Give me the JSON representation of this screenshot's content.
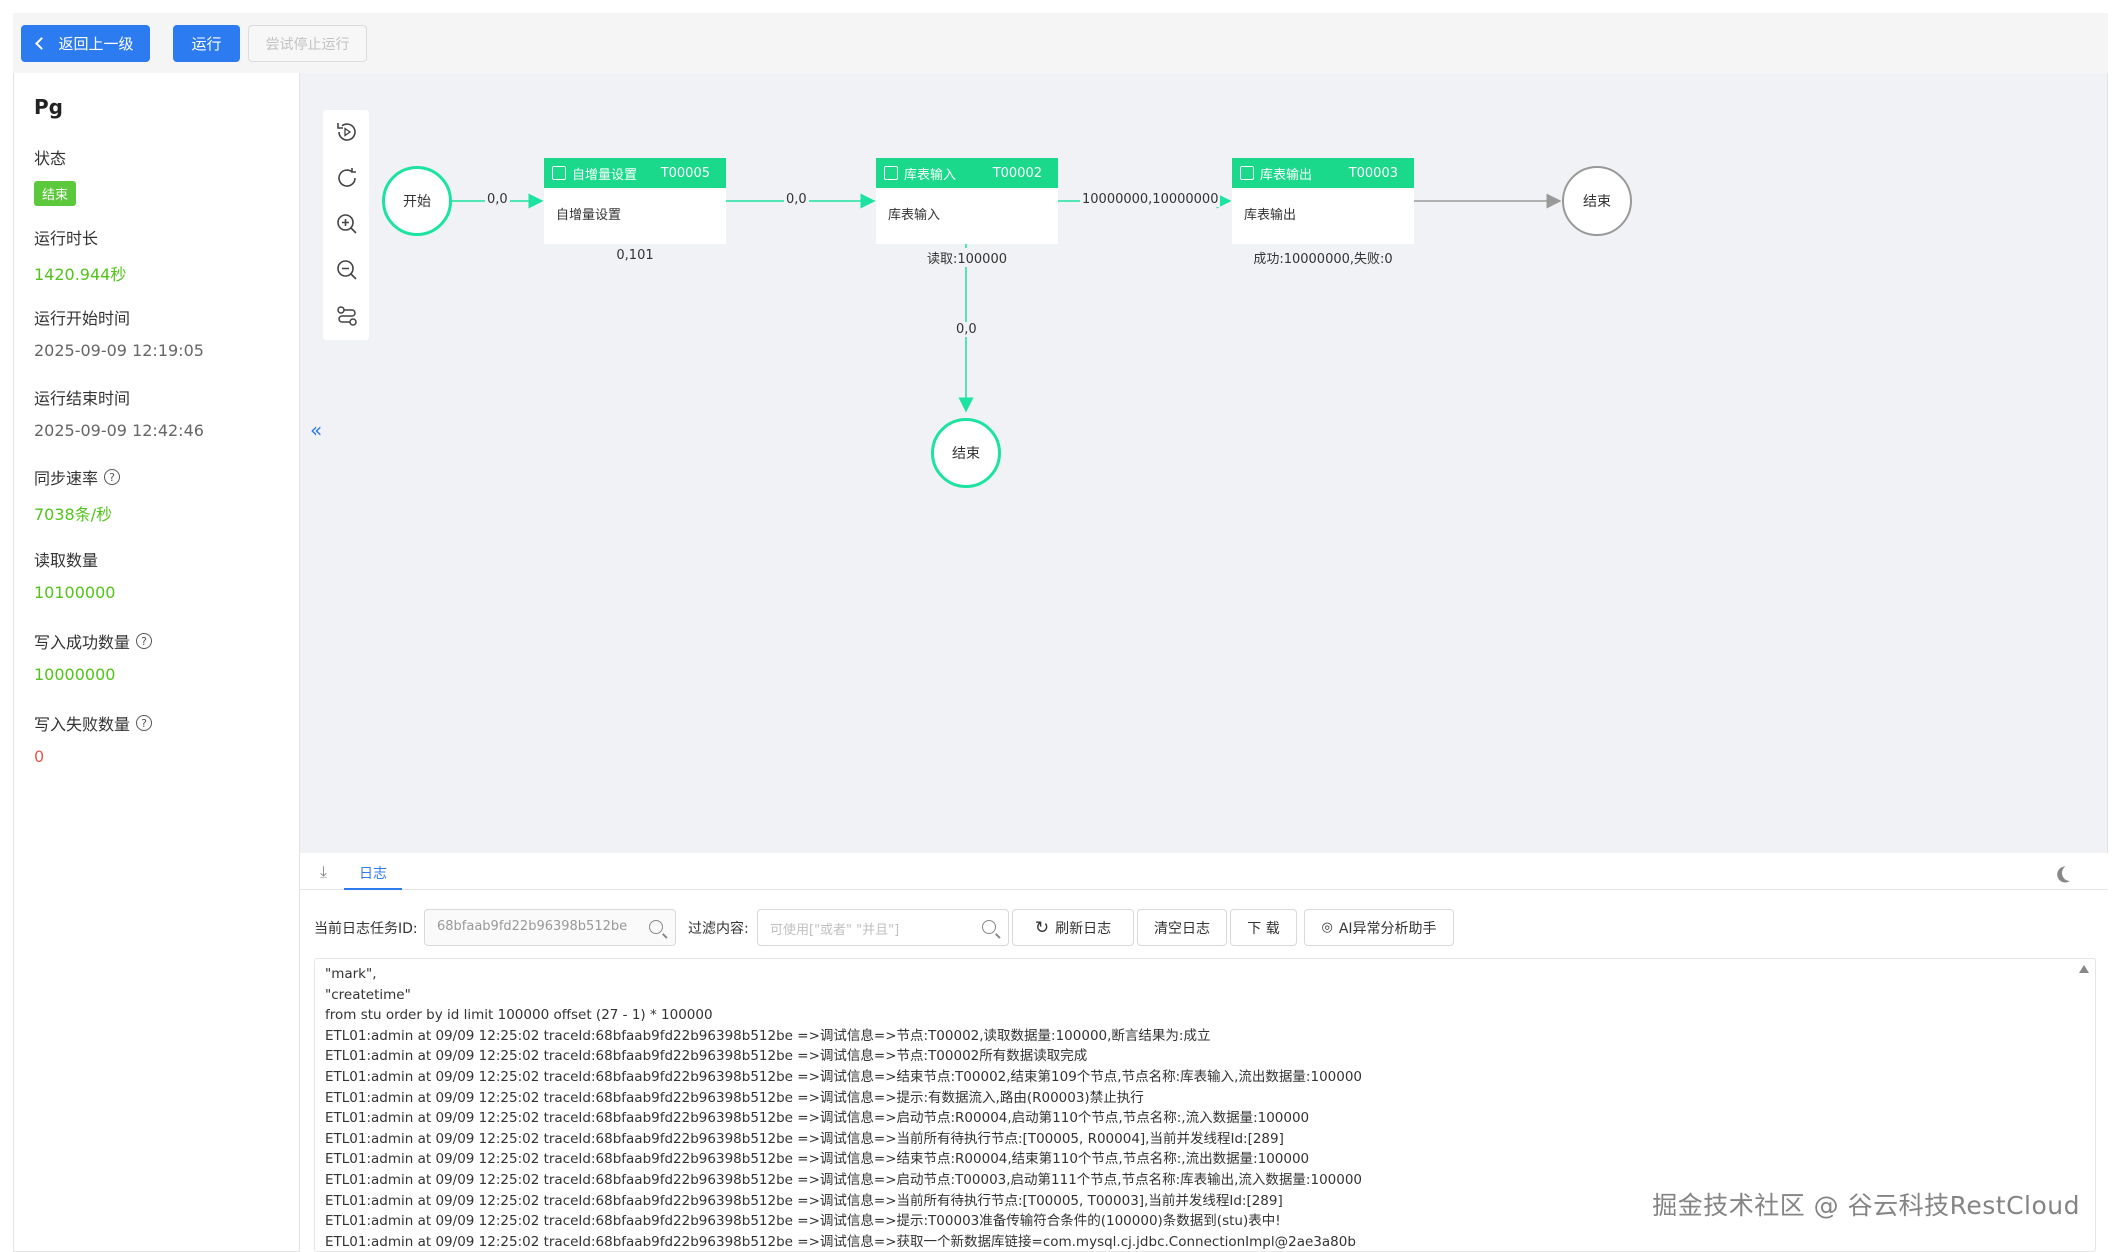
{
  "toolbar": {
    "back_label": "返回上一级",
    "run_label": "运行",
    "stop_label": "尝试停止运行"
  },
  "info": {
    "title": "Pg",
    "status_label": "状态",
    "status_value": "结束",
    "duration_label": "运行时长",
    "duration_value": "1420.944秒",
    "start_label": "运行开始时间",
    "start_value": "2025-09-09 12:19:05",
    "end_label": "运行结束时间",
    "end_value": "2025-09-09 12:42:46",
    "rate_label": "同步速率",
    "rate_value": "7038条/秒",
    "read_label": "读取数量",
    "read_value": "10100000",
    "success_label": "写入成功数量",
    "success_value": "10000000",
    "fail_label": "写入失败数量",
    "fail_value": "0"
  },
  "flow": {
    "start_label": "开始",
    "end_label": "结束",
    "end2_label": "结束",
    "nodes": [
      {
        "title": "自增量设置",
        "id": "T00005",
        "body": "自增量设置",
        "stat": "0,101"
      },
      {
        "title": "库表输入",
        "id": "T00002",
        "body": "库表输入",
        "stat": "读取:100000"
      },
      {
        "title": "库表输出",
        "id": "T00003",
        "body": "库表输出",
        "stat": "成功:10000000,失败:0"
      }
    ],
    "edges": [
      "0,0",
      "0,0",
      "10000000,10000000",
      "0,0"
    ]
  },
  "log": {
    "tab_label": "日志",
    "task_id_label": "当前日志任务ID:",
    "task_id_value": "68bfaab9fd22b96398b512be",
    "filter_label": "过滤内容:",
    "filter_placeholder": "可使用[\"或者\" \"并且\"]",
    "refresh_label": "刷新日志",
    "clear_label": "清空日志",
    "download_label": "下 载",
    "ai_label": "AI异常分析助手",
    "lines": [
      "\"mark\",",
      "\"createtime\"",
      "from stu order by id limit 100000 offset (27 - 1) * 100000",
      "ETL01:admin at 09/09 12:25:02 traceId:68bfaab9fd22b96398b512be =>调试信息=>节点:T00002,读取数据量:100000,断言结果为:成立",
      "ETL01:admin at 09/09 12:25:02 traceId:68bfaab9fd22b96398b512be =>调试信息=>节点:T00002所有数据读取完成",
      "ETL01:admin at 09/09 12:25:02 traceId:68bfaab9fd22b96398b512be =>调试信息=>结束节点:T00002,结束第109个节点,节点名称:库表输入,流出数据量:100000",
      "ETL01:admin at 09/09 12:25:02 traceId:68bfaab9fd22b96398b512be =>调试信息=>提示:有数据流入,路由(R00003)禁止执行",
      "ETL01:admin at 09/09 12:25:02 traceId:68bfaab9fd22b96398b512be =>调试信息=>启动节点:R00004,启动第110个节点,节点名称:,流入数据量:100000",
      "ETL01:admin at 09/09 12:25:02 traceId:68bfaab9fd22b96398b512be =>调试信息=>当前所有待执行节点:[T00005, R00004],当前并发线程Id:[289]",
      "ETL01:admin at 09/09 12:25:02 traceId:68bfaab9fd22b96398b512be =>调试信息=>结束节点:R00004,结束第110个节点,节点名称:,流出数据量:100000",
      "ETL01:admin at 09/09 12:25:02 traceId:68bfaab9fd22b96398b512be =>调试信息=>启动节点:T00003,启动第111个节点,节点名称:库表输出,流入数据量:100000",
      "ETL01:admin at 09/09 12:25:02 traceId:68bfaab9fd22b96398b512be =>调试信息=>当前所有待执行节点:[T00005, T00003],当前并发线程Id:[289]",
      "ETL01:admin at 09/09 12:25:02 traceId:68bfaab9fd22b96398b512be =>调试信息=>提示:T00003准备传输符合条件的(100000)条数据到(stu)表中!",
      "ETL01:admin at 09/09 12:25:02 traceId:68bfaab9fd22b96398b512be =>调试信息=>获取一个新数据库链接=com.mysql.cj.jdbc.ConnectionImpl@2ae3a80b"
    ]
  },
  "watermark": "掘金技术社区 @ 谷云科技RestCloud",
  "colors": {
    "primary": "#2d7bf0",
    "node_green": "#1ad98a",
    "value_green": "#52c41a",
    "fail_red": "#e35a4f"
  }
}
